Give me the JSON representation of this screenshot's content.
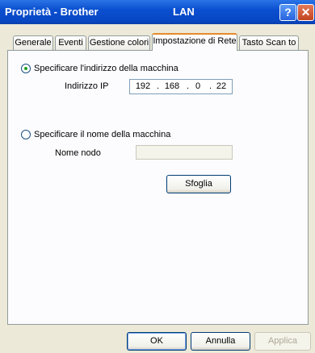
{
  "window": {
    "title": "Proprietà - Brother",
    "subtitle": "LAN",
    "help_glyph": "?",
    "close_glyph": "✕"
  },
  "tabs": [
    {
      "label": "Generale"
    },
    {
      "label": "Eventi"
    },
    {
      "label": "Gestione colori"
    },
    {
      "label": "Impostazione di Rete"
    },
    {
      "label": "Tasto Scan to"
    }
  ],
  "active_tab": "Impostazione di Rete",
  "network": {
    "option_address": "Specificare l'indirizzo della macchina",
    "ip_label": "Indirizzo IP",
    "ip": [
      "192",
      "168",
      "0",
      "22"
    ],
    "option_name": "Specificare il nome della macchina",
    "node_label": "Nome nodo",
    "node_value": "",
    "browse_label": "Sfoglia",
    "selected_option": "address"
  },
  "footer": {
    "ok": "OK",
    "cancel": "Annulla",
    "apply": "Applica"
  }
}
